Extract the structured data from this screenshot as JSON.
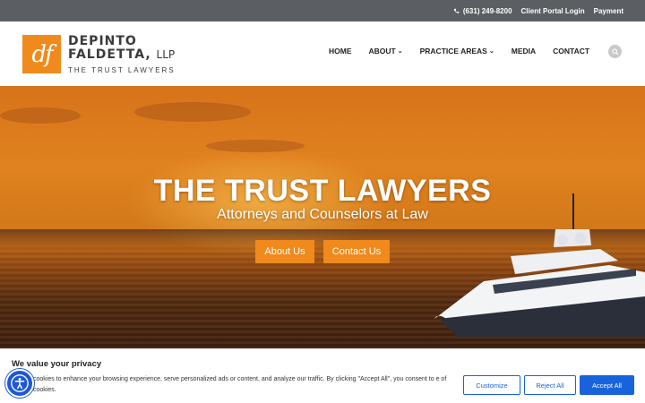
{
  "topbar": {
    "phone": "(631) 249-8200",
    "portal": "Client Portal Login",
    "payment": "Payment"
  },
  "logo": {
    "mark": "df",
    "line1": "DEPINTO",
    "line2": "FALDETTA,",
    "llp": "LLP",
    "tagline": "THE TRUST LAWYERS"
  },
  "nav": {
    "items": [
      {
        "label": "HOME"
      },
      {
        "label": "ABOUT",
        "dropdown": true
      },
      {
        "label": "PRACTICE AREAS",
        "dropdown": true
      },
      {
        "label": "MEDIA"
      },
      {
        "label": "CONTACT"
      }
    ]
  },
  "hero": {
    "title": "THE TRUST LAWYERS",
    "subtitle": "Attorneys and Counselors at Law",
    "btn_about": "About Us",
    "btn_contact": "Contact Us"
  },
  "cookie": {
    "title": "We value your privacy",
    "text": "cookies to enhance your browsing experience, serve personalized ads or content, and analyze our traffic. By clicking \"Accept All\", you consent to e of cookies.",
    "customize": "Customize",
    "reject": "Reject All",
    "accept": "Accept All"
  },
  "colors": {
    "brand_orange": "#f08a1d",
    "topbar_gray": "#5b5f63",
    "cookie_blue": "#1863dc"
  },
  "icons": {
    "phone": "phone-icon",
    "search": "search-icon",
    "accessibility": "accessibility-icon",
    "chevron": "chevron-down-icon"
  }
}
